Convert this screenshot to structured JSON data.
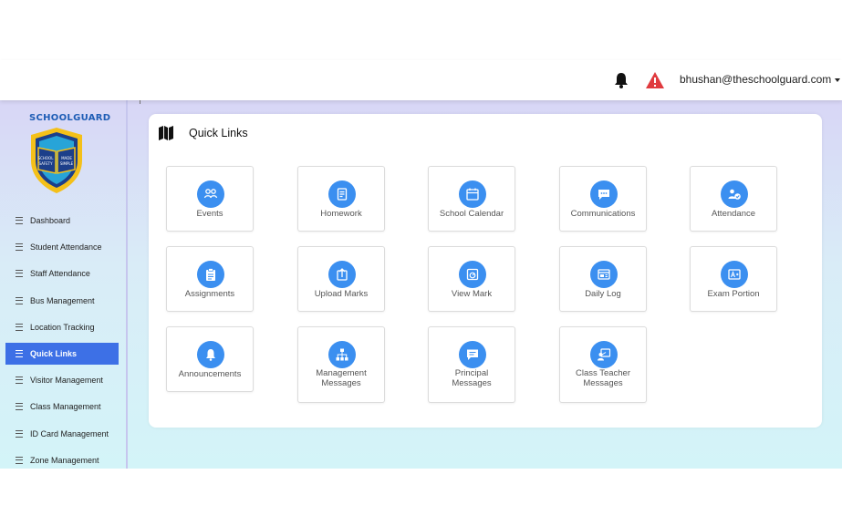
{
  "header": {
    "user_email": "bhushan@theschoolguard.com",
    "icons": [
      "bell-icon",
      "warning-icon",
      "chevron-down-icon"
    ]
  },
  "brand": {
    "name": "SCHOOLGUARD",
    "badge_lines": [
      "SCHOOL",
      "SAFETY",
      "MADE",
      "SIMPLE"
    ]
  },
  "sidebar": {
    "items": [
      {
        "label": "Dashboard"
      },
      {
        "label": "Student Attendance"
      },
      {
        "label": "Staff Attendance"
      },
      {
        "label": "Bus Management"
      },
      {
        "label": "Location Tracking"
      },
      {
        "label": "Quick Links",
        "active": true
      },
      {
        "label": "Visitor Management"
      },
      {
        "label": "Class Management"
      },
      {
        "label": "ID Card Management"
      },
      {
        "label": "Zone Management"
      }
    ]
  },
  "main": {
    "title": "Quick Links",
    "links": [
      {
        "label": "Events",
        "icon": "people-icon"
      },
      {
        "label": "Homework",
        "icon": "document-icon"
      },
      {
        "label": "School Calendar",
        "icon": "calendar-icon"
      },
      {
        "label": "Communications",
        "icon": "chat-icon"
      },
      {
        "label": "Attendance",
        "icon": "attendance-icon"
      },
      {
        "label": "Assignments",
        "icon": "clipboard-icon"
      },
      {
        "label": "Upload Marks",
        "icon": "upload-icon"
      },
      {
        "label": "View Mark",
        "icon": "view-mark-icon"
      },
      {
        "label": "Daily Log",
        "icon": "log-icon"
      },
      {
        "label": "Exam Portion",
        "icon": "grade-icon"
      },
      {
        "label": "Announcements",
        "icon": "bell-icon"
      },
      {
        "label": "Management\nMessages",
        "icon": "org-chart-icon"
      },
      {
        "label": "Principal\nMessages",
        "icon": "message-icon"
      },
      {
        "label": "Class Teacher\nMessages",
        "icon": "teacher-icon"
      }
    ]
  },
  "colors": {
    "accent": "#3d70e6",
    "icon_circle": "#3b8ff0",
    "warning": "#e03a3e",
    "brand_text": "#1e5db5"
  }
}
